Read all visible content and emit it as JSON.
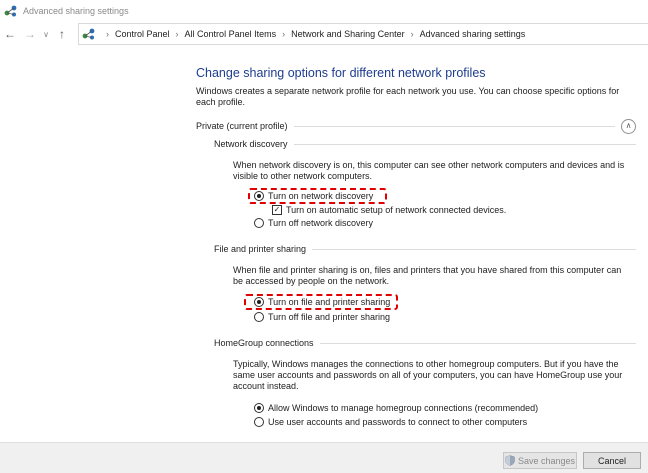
{
  "window": {
    "title": "Advanced sharing settings"
  },
  "nav": {
    "back_glyph": "←",
    "forward_glyph": "→",
    "dropdown_glyph": "∨",
    "up_glyph": "↑",
    "breadcrumbs": [
      "Control Panel",
      "All Control Panel Items",
      "Network and Sharing Center",
      "Advanced sharing settings"
    ],
    "sep_glyph": "›"
  },
  "main": {
    "heading": "Change sharing options for different network profiles",
    "intro": "Windows creates a separate network profile for each network you use. You can choose specific options for each profile.",
    "profile": {
      "label": "Private (current profile)",
      "collapse_glyph": "∧"
    },
    "network_discovery": {
      "title": "Network discovery",
      "description": "When network discovery is on, this computer can see other network computers and devices and is visible to other network computers.",
      "on_label": "Turn on network discovery",
      "auto_setup_label": "Turn on automatic setup of network connected devices.",
      "off_label": "Turn off network discovery",
      "check_glyph": "✓"
    },
    "file_printer_sharing": {
      "title": "File and printer sharing",
      "description": "When file and printer sharing is on, files and printers that you have shared from this computer can be accessed by people on the network.",
      "on_label": "Turn on file and printer sharing",
      "off_label": "Turn off file and printer sharing"
    },
    "homegroup": {
      "title": "HomeGroup connections",
      "description": "Typically, Windows manages the connections to other homegroup computers. But if you have the same user accounts and passwords on all of your computers, you can have HomeGroup use your account instead.",
      "allow_label": "Allow Windows to manage homegroup connections (recommended)",
      "use_accounts_label": "Use user accounts and passwords to connect to other computers"
    }
  },
  "footer": {
    "save_label": "Save changes",
    "cancel_label": "Cancel"
  },
  "colors": {
    "heading": "#1e3d8f",
    "highlight": "#e00000",
    "footer_bg": "#f0f0f0"
  }
}
